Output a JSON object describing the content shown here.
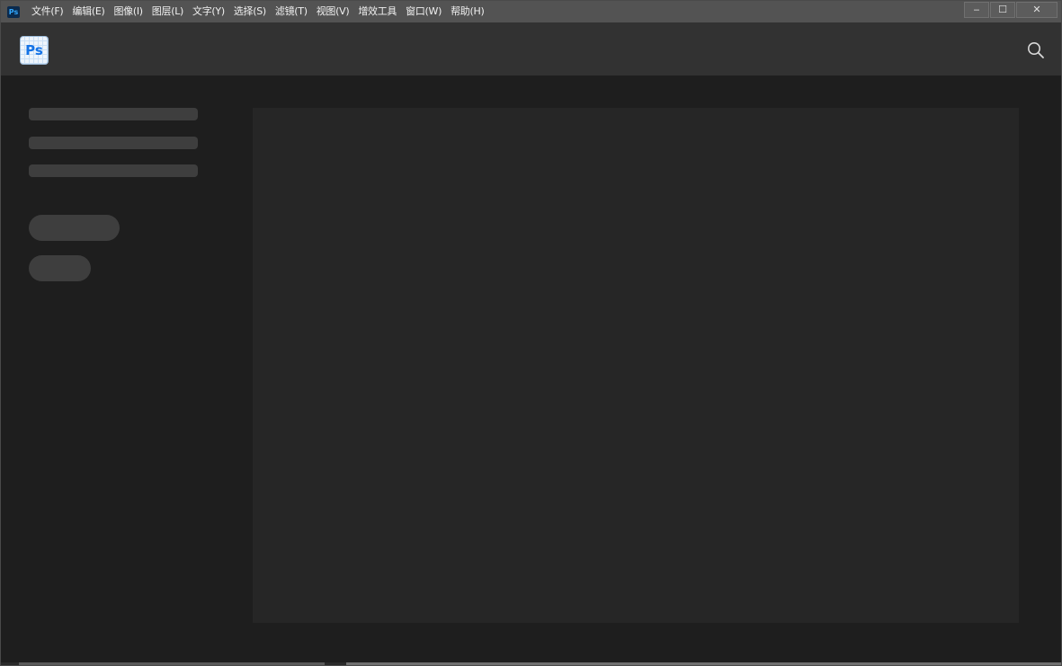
{
  "app": {
    "small_icon_text": "Ps",
    "logo_text": "Ps",
    "accent_color": "#31a8ff"
  },
  "menu": {
    "items": [
      {
        "label": "文件(F)"
      },
      {
        "label": "编辑(E)"
      },
      {
        "label": "图像(I)"
      },
      {
        "label": "图层(L)"
      },
      {
        "label": "文字(Y)"
      },
      {
        "label": "选择(S)"
      },
      {
        "label": "滤镜(T)"
      },
      {
        "label": "视图(V)"
      },
      {
        "label": "增效工具"
      },
      {
        "label": "窗口(W)"
      },
      {
        "label": "帮助(H)"
      }
    ]
  },
  "window_controls": {
    "minimize": "‒",
    "maximize": "☐",
    "close": "✕"
  },
  "header": {
    "search_icon": "search-icon"
  }
}
